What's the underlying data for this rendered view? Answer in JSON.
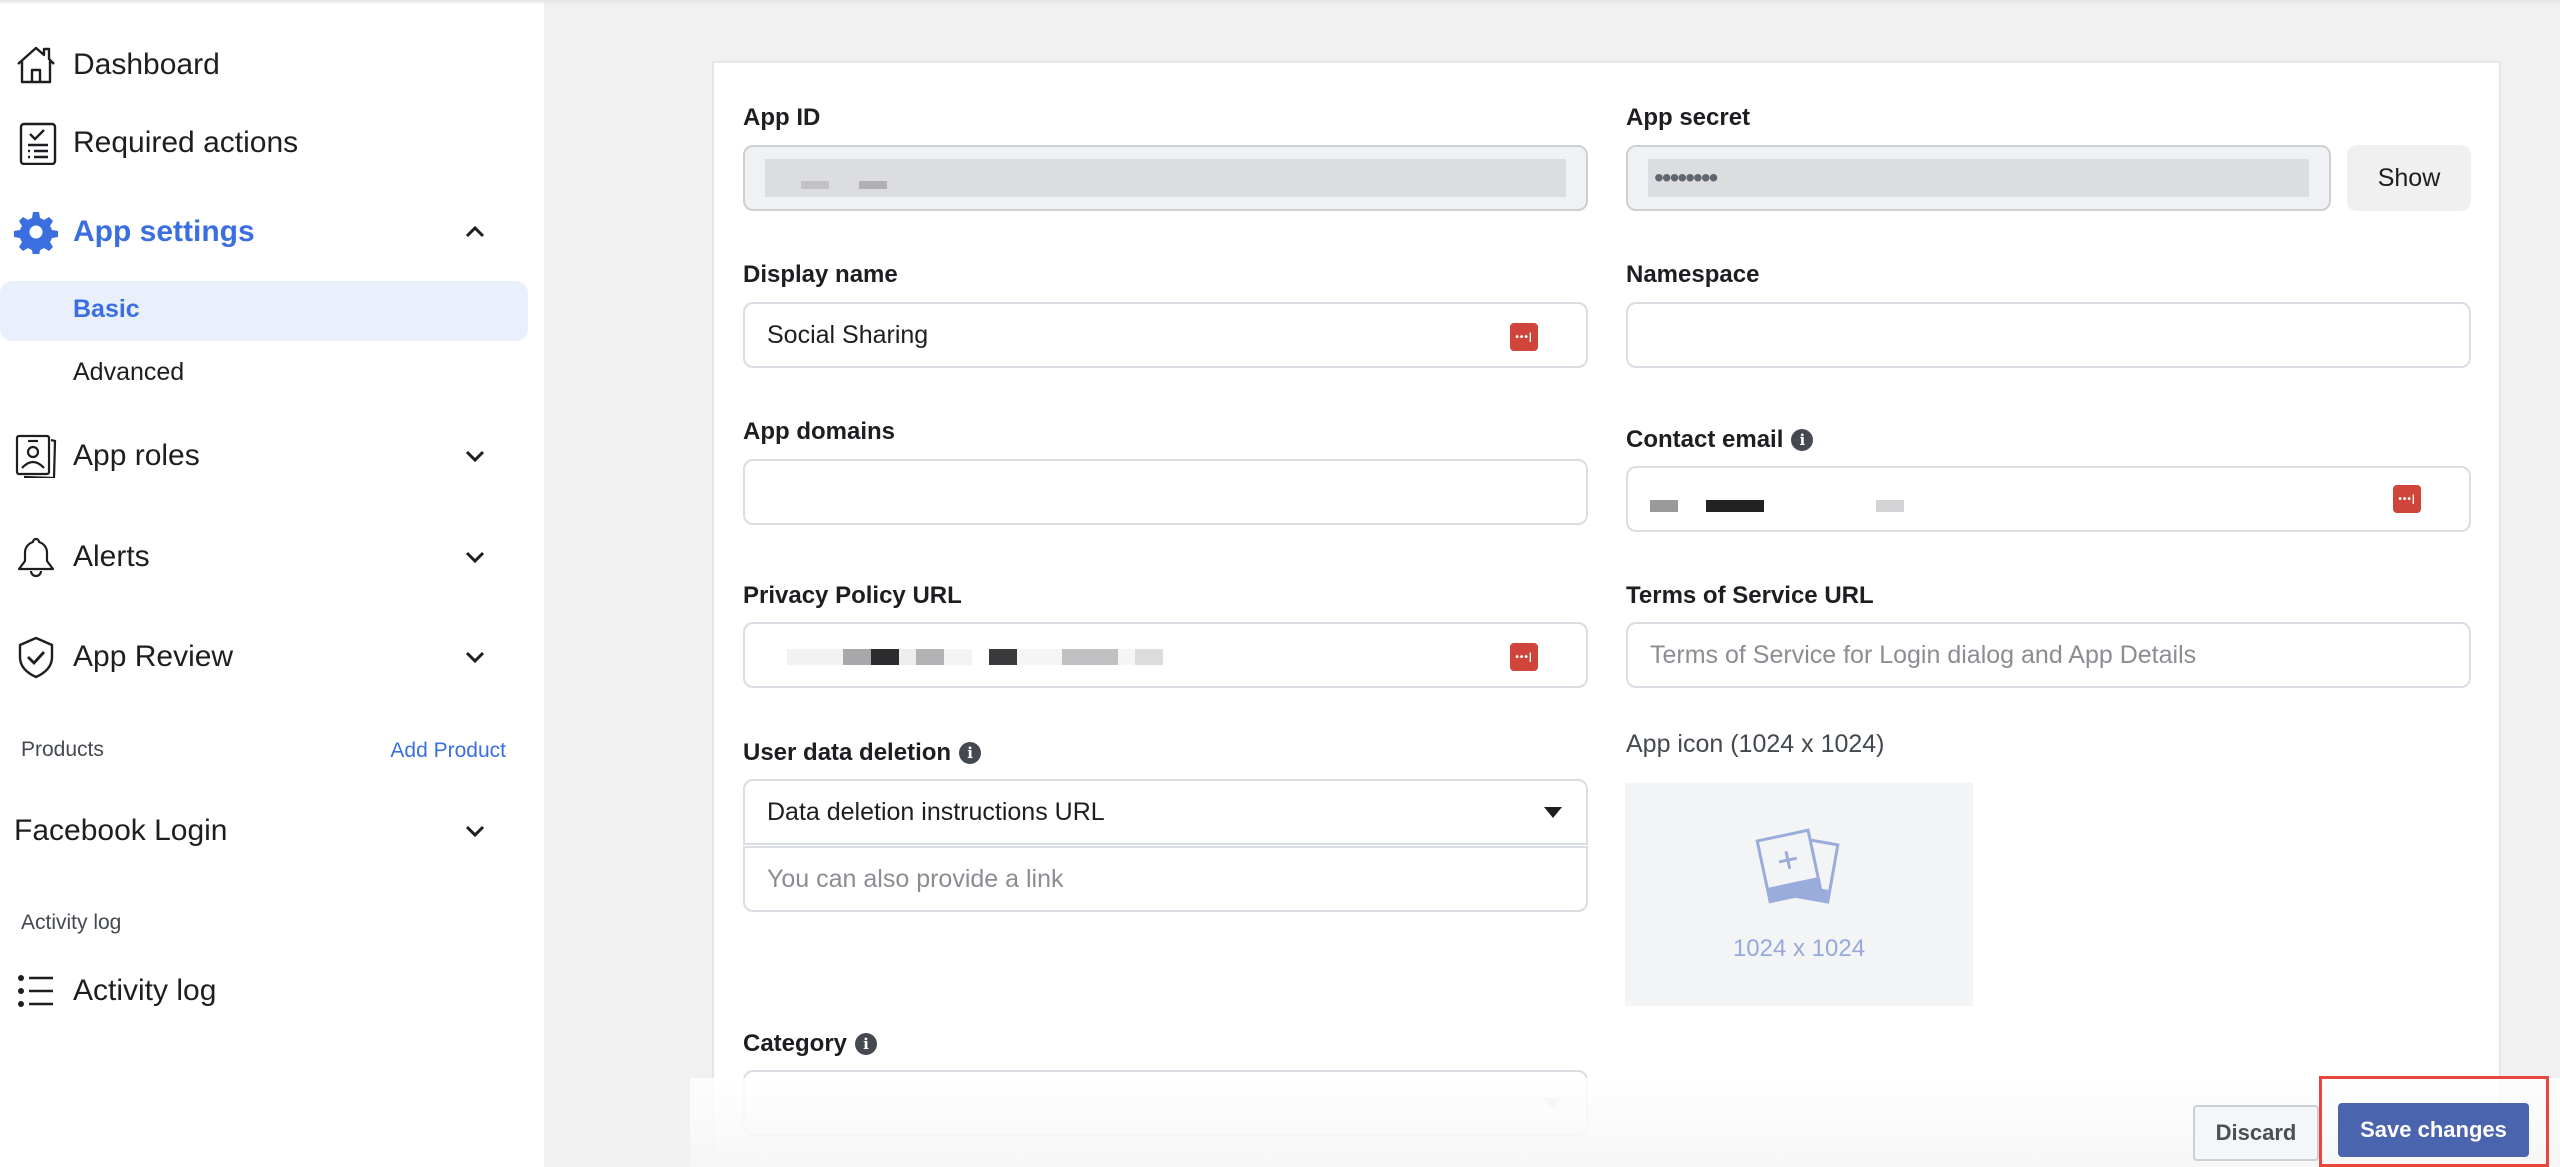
{
  "sidebar": {
    "items": [
      {
        "label": "Dashboard",
        "icon": "home-icon"
      },
      {
        "label": "Required actions",
        "icon": "checklist-icon"
      },
      {
        "label": "App settings",
        "icon": "gear-icon",
        "expanded": true,
        "active": true
      },
      {
        "label": "App roles",
        "icon": "id-badge-icon"
      },
      {
        "label": "Alerts",
        "icon": "bell-icon"
      },
      {
        "label": "App Review",
        "icon": "shield-check-icon"
      }
    ],
    "app_settings_sub": [
      {
        "label": "Basic",
        "active": true
      },
      {
        "label": "Advanced"
      }
    ],
    "products_title": "Products",
    "add_product_label": "Add Product",
    "facebook_login_label": "Facebook Login",
    "activity_section_title": "Activity log",
    "activity_log_label": "Activity log"
  },
  "form": {
    "app_id": {
      "label": "App ID",
      "value": ""
    },
    "app_secret": {
      "label": "App secret",
      "value": "••••••••",
      "show_label": "Show"
    },
    "display_name": {
      "label": "Display name",
      "value": "Social Sharing"
    },
    "namespace": {
      "label": "Namespace",
      "value": ""
    },
    "app_domains": {
      "label": "App domains",
      "value": ""
    },
    "contact_email": {
      "label": "Contact email",
      "value": ""
    },
    "privacy_policy_url": {
      "label": "Privacy Policy URL",
      "value": ""
    },
    "terms_of_service_url": {
      "label": "Terms of Service URL",
      "placeholder": "Terms of Service for Login dialog and App Details"
    },
    "user_data_deletion": {
      "label": "User data deletion",
      "selected": "Data deletion instructions URL",
      "link_placeholder": "You can also provide a link"
    },
    "app_icon": {
      "label": "App icon (1024 x 1024)",
      "size_text": "1024 x 1024"
    },
    "category": {
      "label": "Category",
      "selected": ""
    }
  },
  "footer": {
    "discard_label": "Discard",
    "save_label": "Save changes"
  },
  "colors": {
    "accent": "#3b6fe0",
    "save_button": "#4a64ad",
    "highlight": "#e8453c",
    "lastpass": "#d0453b"
  }
}
